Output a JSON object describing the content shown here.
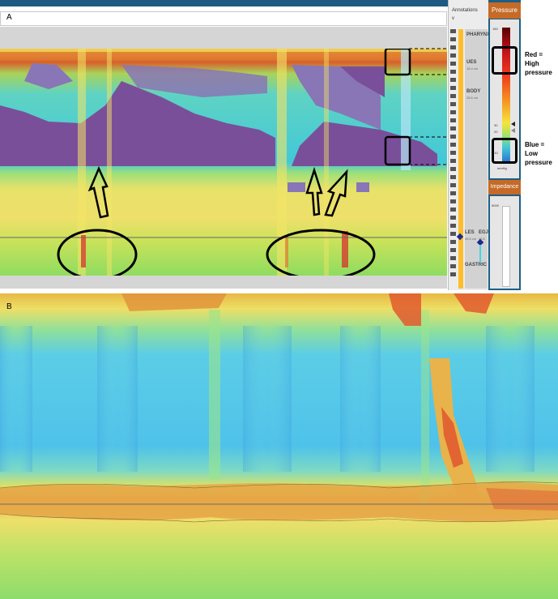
{
  "panels": {
    "a_label": "A",
    "b_label": "B"
  },
  "annotations": {
    "title": "Annotations",
    "arrow": "v"
  },
  "regions": [
    {
      "name": "PHARYNX",
      "sub": ""
    },
    {
      "name": "UES",
      "sub": "18.4 cm"
    },
    {
      "name": "BODY",
      "sub": "28.6 cm"
    },
    {
      "name": "LES",
      "sub": "45.6 cm"
    },
    {
      "name": "EGJ",
      "sub": "45.6 cm"
    },
    {
      "name": "GASTRIC",
      "sub": ""
    }
  ],
  "pressure_scale": {
    "title": "Pressure",
    "top_value": "150",
    "ticks": [
      "30",
      "20",
      "-10"
    ],
    "unit": "mmHg"
  },
  "impedance": {
    "title": "Impedance",
    "value": "5000"
  },
  "legend": {
    "red_label_1": "Red = High",
    "red_label_2": "pressure",
    "blue_label_1": "Blue = Low",
    "blue_label_2": "pressure"
  },
  "colors": {
    "header_blue": "#1f5a80",
    "pressure_header": "#c56a27",
    "high": "#d6262a",
    "low": "#2f86d6",
    "contraction": "#7a4f9a"
  }
}
